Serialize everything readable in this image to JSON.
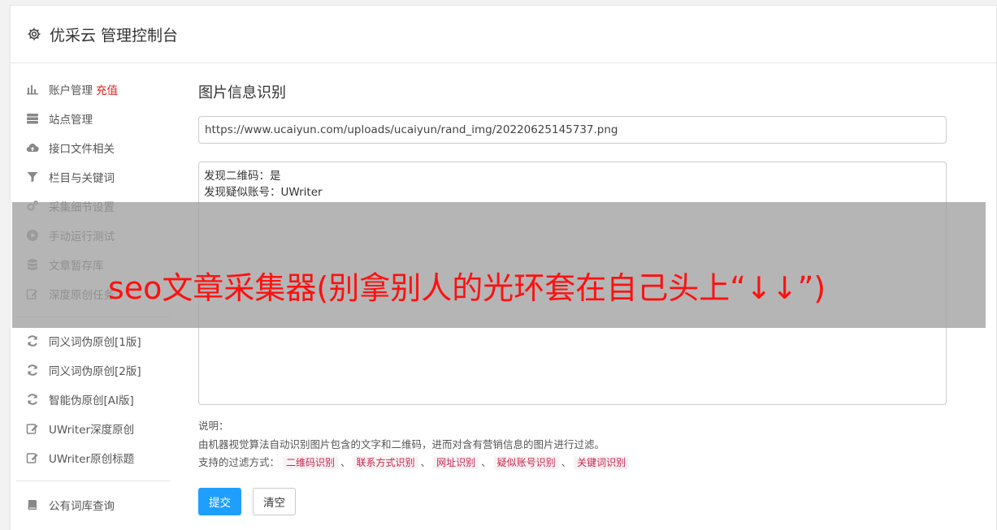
{
  "header": {
    "title": "优采云 管理控制台"
  },
  "sidebar": {
    "groups": [
      [
        {
          "label": "账户管理",
          "extra": "充值",
          "icon": "bar-chart-icon"
        },
        {
          "label": "站点管理",
          "icon": "server-icon"
        },
        {
          "label": "接口文件相关",
          "icon": "cloud-upload-icon"
        },
        {
          "label": "栏目与关键词",
          "icon": "filter-icon"
        },
        {
          "label": "采集细节设置",
          "icon": "gears-icon"
        },
        {
          "label": "手动运行测试",
          "icon": "play-circle-icon"
        },
        {
          "label": "文章暂存库",
          "icon": "database-icon"
        },
        {
          "label": "深度原创任务",
          "icon": "edit-icon"
        }
      ],
      [
        {
          "label": "同义词伪原创[1版]",
          "icon": "refresh-icon"
        },
        {
          "label": "同义词伪原创[2版]",
          "icon": "refresh-icon"
        },
        {
          "label": "智能伪原创[AI版]",
          "icon": "refresh-icon"
        },
        {
          "label": "UWriter深度原创",
          "icon": "edit-icon"
        },
        {
          "label": "UWriter原创标题",
          "icon": "edit-icon"
        }
      ],
      [
        {
          "label": "公有词库查询",
          "icon": "book-icon"
        }
      ]
    ]
  },
  "main": {
    "title": "图片信息识别",
    "url_value": "https://www.ucaiyun.com/uploads/ucaiyun/rand_img/20220625145737.png",
    "result_lines": [
      "发现二维码：是",
      "发现疑似账号：UWriter"
    ],
    "desc_label": "说明：",
    "desc_text": "由机器视觉算法自动识别图片包含的文字和二维码，进而对含有营销信息的图片进行过滤。",
    "filters_label": "支持的过滤方式：",
    "filters": [
      "二维码识别",
      "联系方式识别",
      "网址识别",
      "疑似账号识别",
      "关键词识别"
    ],
    "filter_sep": "、",
    "submit_label": "提交",
    "clear_label": "清空"
  },
  "overlay": {
    "text": "seo文章采集器(别拿别人的光环套在自己头上“↓↓”)"
  }
}
